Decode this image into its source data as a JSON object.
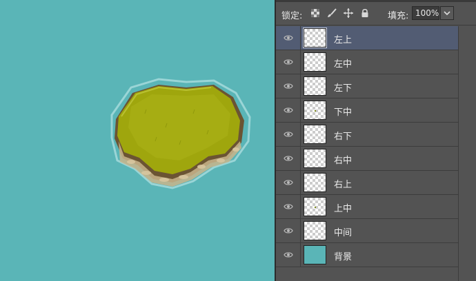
{
  "lock_bar": {
    "label": "锁定:",
    "icons": [
      "lock-transparent-pixels-icon",
      "lock-image-pixels-icon",
      "lock-position-icon",
      "lock-all-icon"
    ],
    "fill_label": "填充:",
    "fill_value": "100%"
  },
  "layers": [
    {
      "name": "左上",
      "selected": true,
      "thumb": "transparent"
    },
    {
      "name": "左中",
      "selected": false,
      "thumb": "transparent"
    },
    {
      "name": "左下",
      "selected": false,
      "thumb": "transparent"
    },
    {
      "name": "下中",
      "selected": false,
      "thumb": "transparent"
    },
    {
      "name": "右下",
      "selected": false,
      "thumb": "transparent"
    },
    {
      "name": "右中",
      "selected": false,
      "thumb": "transparent"
    },
    {
      "name": "右上",
      "selected": false,
      "thumb": "transparent"
    },
    {
      "name": "上中",
      "selected": false,
      "thumb": "transparent"
    },
    {
      "name": "中间",
      "selected": false,
      "thumb": "transparent"
    },
    {
      "name": "背景",
      "selected": false,
      "thumb": "solid"
    }
  ],
  "colors": {
    "canvas_bg": "#5ab5b7",
    "panel_bg": "#535353",
    "selected_row": "#525c73",
    "grass": "#9fa60d",
    "dirt": "#6b5433"
  }
}
